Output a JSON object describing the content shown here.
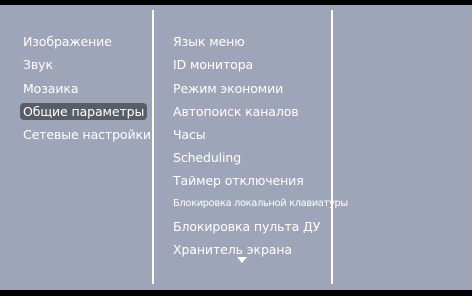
{
  "left_menu": {
    "items": [
      {
        "label": "Изображение",
        "selected": false
      },
      {
        "label": "Звук",
        "selected": false
      },
      {
        "label": "Мозаика",
        "selected": false
      },
      {
        "label": "Общие параметры",
        "selected": true
      },
      {
        "label": "Сетевые настройки",
        "selected": false
      }
    ]
  },
  "sub_menu": {
    "items": [
      {
        "label": "Язык меню"
      },
      {
        "label": "ID монитора"
      },
      {
        "label": "Режим экономии"
      },
      {
        "label": "Автопоиск каналов"
      },
      {
        "label": "Часы"
      },
      {
        "label": "Scheduling"
      },
      {
        "label": "Таймер отключения"
      },
      {
        "label": "Блокировка локальной клавиатуры"
      },
      {
        "label": "Блокировка пульта ДУ"
      },
      {
        "label": "Хранитель экрана"
      }
    ],
    "scroll_indicator_icon": "down-arrow-icon"
  },
  "colors": {
    "panel_background": "#9fa5b9",
    "selection_highlight": "#595d67",
    "text": "#ffffff",
    "frame": "#000000"
  }
}
